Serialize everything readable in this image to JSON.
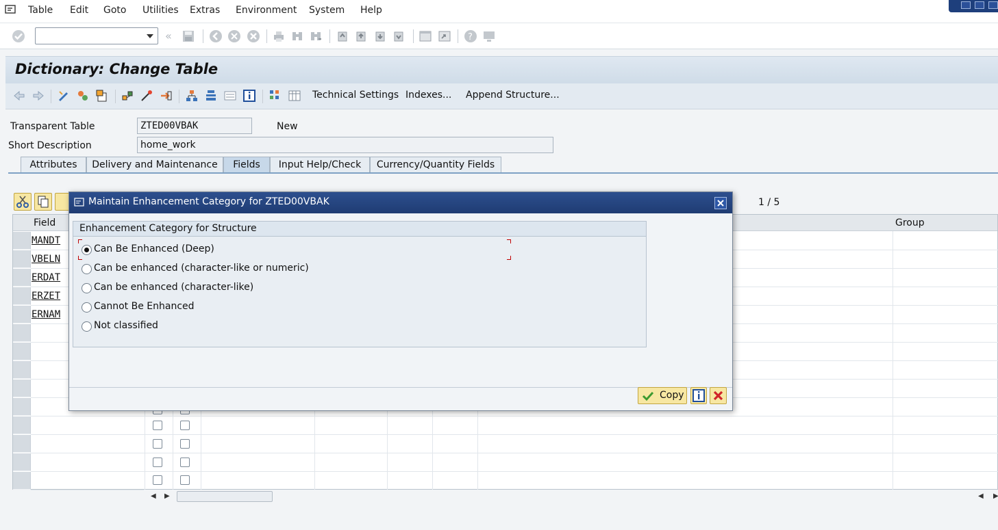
{
  "menu": {
    "items": [
      "Table",
      "Edit",
      "Goto",
      "Utilities",
      "Extras",
      "Environment",
      "System",
      "Help"
    ]
  },
  "title": "Dictionary: Change Table",
  "app_toolbar": {
    "technical_settings": "Technical Settings",
    "indexes": "Indexes...",
    "append_structure": "Append Structure..."
  },
  "header": {
    "table_label": "Transparent Table",
    "table_value": "ZTED00VBAK",
    "status": "New",
    "short_desc_label": "Short Description",
    "short_desc_value": "home_work"
  },
  "tabs": [
    "Attributes",
    "Delivery and Maintenance",
    "Fields",
    "Input Help/Check",
    "Currency/Quantity Fields"
  ],
  "active_tab": "Fields",
  "grid": {
    "page_indicator": "1  /  5",
    "col_field": "Field",
    "col_group": "Group",
    "fields": [
      "MANDT",
      "VBELN",
      "ERDAT",
      "ERZET",
      "ERNAM"
    ]
  },
  "dialog": {
    "title": "Maintain Enhancement Category for ZTED00VBAK",
    "group_title": "Enhancement Category for Structure",
    "options": [
      {
        "label": "Can Be Enhanced (Deep)",
        "selected": true
      },
      {
        "label": "Can be enhanced (character-like or numeric)",
        "selected": false
      },
      {
        "label": "Can be enhanced (character-like)",
        "selected": false
      },
      {
        "label": "Cannot Be Enhanced",
        "selected": false
      },
      {
        "label": "Not classified",
        "selected": false
      }
    ],
    "copy_label": "Copy"
  },
  "colors": {
    "dialog_title_bg": "#1f3c73",
    "button_bg": "#f7e7a2",
    "tab_active": "#c7d8e9",
    "cancel_red": "#d0242a"
  }
}
